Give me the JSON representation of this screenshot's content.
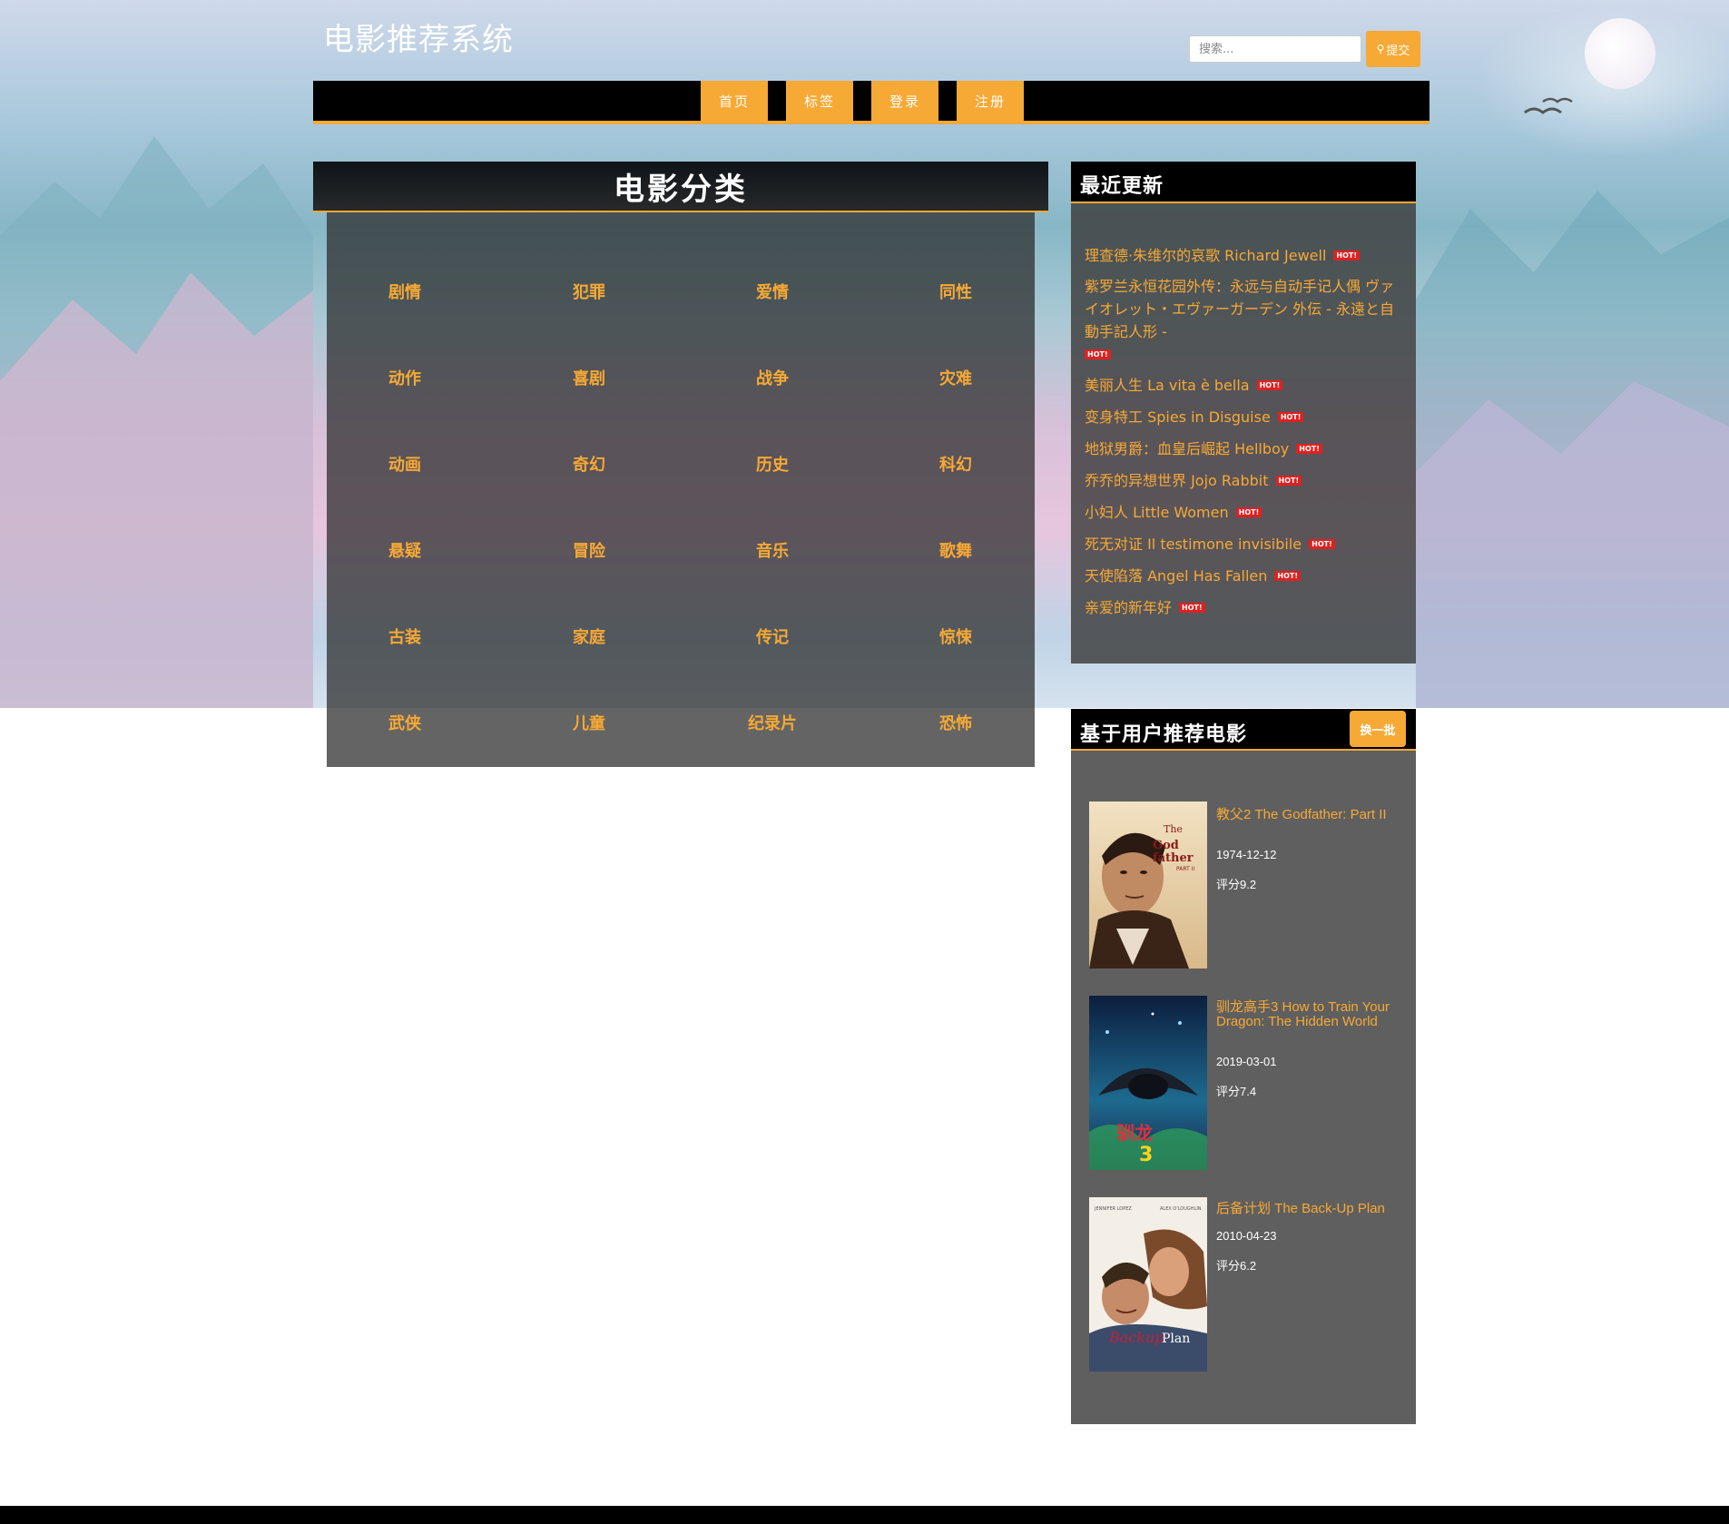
{
  "header": {
    "site_title": "电影推荐系统",
    "search_placeholder": "搜索...",
    "search_button_label": "提交"
  },
  "nav": [
    {
      "label": "首页"
    },
    {
      "label": "标签"
    },
    {
      "label": "登录"
    },
    {
      "label": "注册"
    }
  ],
  "categories": {
    "title": "电影分类",
    "items": [
      "剧情",
      "犯罪",
      "爱情",
      "同性",
      "动作",
      "喜剧",
      "战争",
      "灾难",
      "动画",
      "奇幻",
      "历史",
      "科幻",
      "悬疑",
      "冒险",
      "音乐",
      "歌舞",
      "古装",
      "家庭",
      "传记",
      "惊悚",
      "武侠",
      "儿童",
      "纪录片",
      "恐怖"
    ]
  },
  "recent": {
    "title": "最近更新",
    "hot_badge": "HOT!",
    "items": [
      "理查德·朱维尔的哀歌 Richard Jewell",
      "紫罗兰永恒花园外传：永远与自动手记人偶 ヴァイオレット・エヴァーガーデン 外伝 - 永遠と自動手記人形 -",
      "美丽人生 La vita è bella",
      "变身特工 Spies in Disguise",
      "地狱男爵：血皇后崛起 Hellboy",
      "乔乔的异想世界 Jojo Rabbit",
      "小妇人 Little Women",
      "死无对证 Il testimone invisibile",
      "天使陷落 Angel Has Fallen",
      "亲爱的新年好"
    ]
  },
  "recommend": {
    "title": "基于用户推荐电影",
    "refresh_label": "换一批",
    "movies": [
      {
        "title": "教父2 The Godfather: Part II",
        "date": "1974-12-12",
        "rating": "评分9.2",
        "poster_text": "The Godfather Part II"
      },
      {
        "title": "驯龙高手3 How to Train Your Dragon: The Hidden World",
        "date": "2019-03-01",
        "rating": "评分7.4",
        "poster_text": "驯龙高手3"
      },
      {
        "title": "后备计划 The Back-Up Plan",
        "date": "2010-04-23",
        "rating": "评分6.2",
        "poster_text": "The Back-up Plan"
      }
    ]
  },
  "colors": {
    "accent": "#f7a935",
    "hot": "#e02020"
  }
}
